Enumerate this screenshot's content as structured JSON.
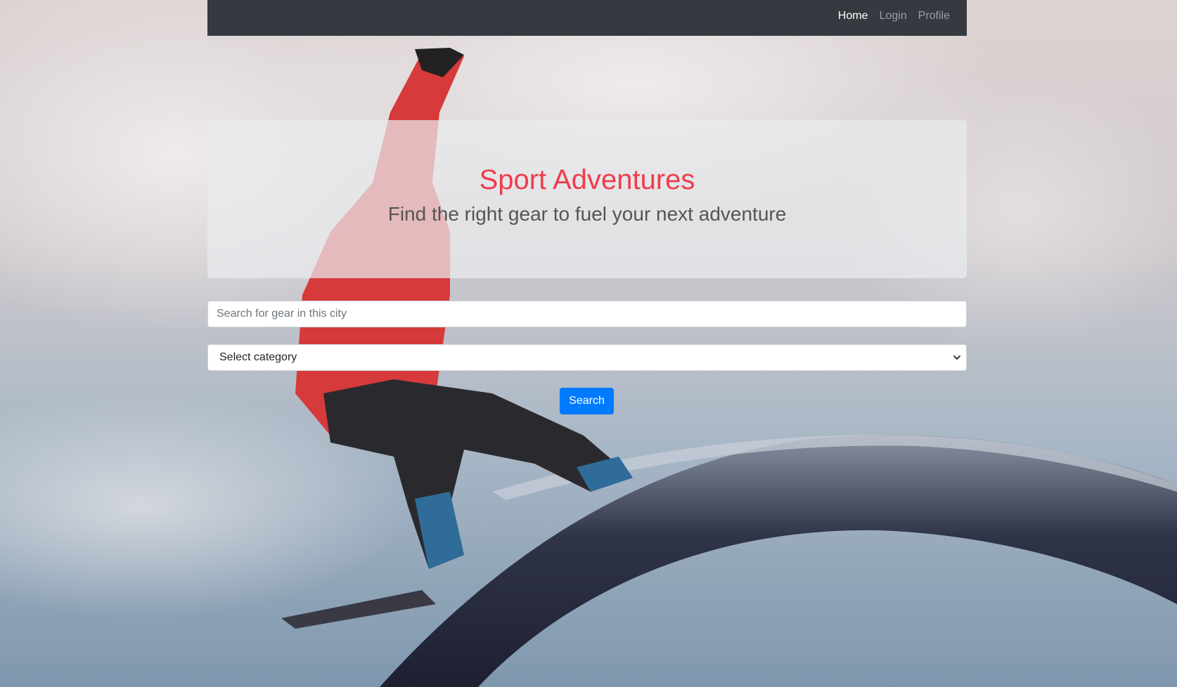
{
  "nav": {
    "items": [
      {
        "label": "Home",
        "active": true
      },
      {
        "label": "Login",
        "active": false
      },
      {
        "label": "Profile",
        "active": false
      }
    ]
  },
  "hero": {
    "title": "Sport Adventures",
    "subtitle": "Find the right gear to fuel your next adventure"
  },
  "search": {
    "placeholder": "Search for gear in this city",
    "value": ""
  },
  "category": {
    "selected": "Select category"
  },
  "button": {
    "search_label": "Search"
  },
  "colors": {
    "navbar": "#343a40",
    "title": "#f03c4b",
    "primary": "#007bff"
  },
  "background": {
    "icon": "snowboarder-photo"
  }
}
